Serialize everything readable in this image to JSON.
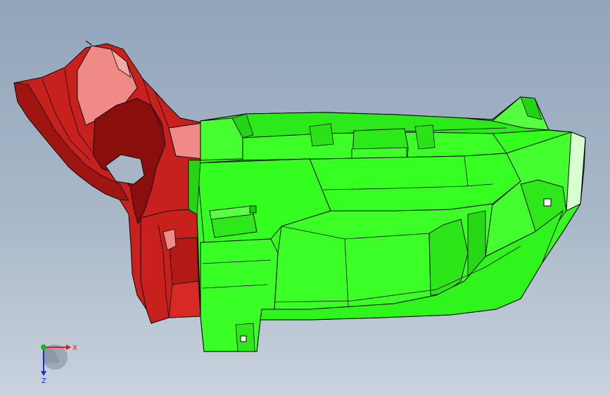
{
  "colors": {
    "background_top": "#93a5bb",
    "background_bottom": "#c9d2dd",
    "red_part": "#c8201c",
    "red_dark": "#7d0d0b",
    "red_highlight": "#f08a86",
    "green_part": "#33ff1f",
    "green_dark": "#19c40c",
    "green_light": "#7dff6b",
    "edge": "#0a0a0a",
    "axis_x": "#e31a1a",
    "axis_y": "#1db81d",
    "axis_z": "#1f2fd6"
  },
  "triad": {
    "x_label": "X",
    "z_label": "Z"
  }
}
